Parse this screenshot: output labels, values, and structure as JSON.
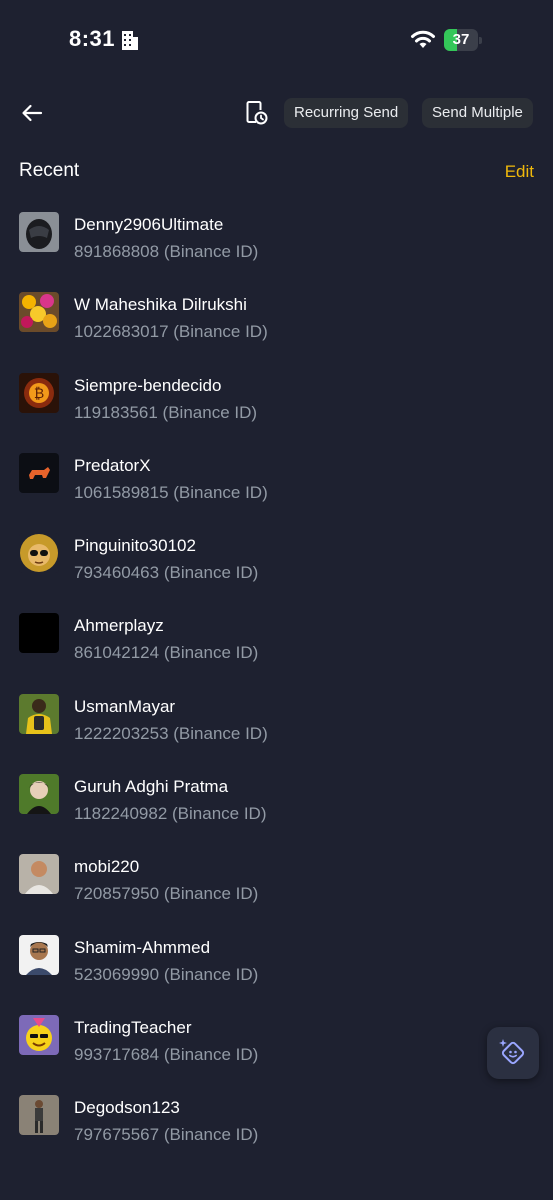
{
  "status_bar": {
    "time": "8:31",
    "battery": "37",
    "battery_level": 0.37,
    "battery_color": "#34c759"
  },
  "toolbar": {
    "back_icon": "arrow-left-icon",
    "history_icon": "clock-document-icon",
    "recurring_send_label": "Recurring Send",
    "send_multiple_label": "Send Multiple"
  },
  "recent": {
    "title": "Recent",
    "edit_label": "Edit",
    "contacts": [
      {
        "name": "Denny2906Ultimate",
        "id": "891868808 (Binance ID)",
        "avatar": "helmet"
      },
      {
        "name": "W Maheshika Dilrukshi",
        "id": "1022683017 (Binance ID)",
        "avatar": "flowers"
      },
      {
        "name": "Siempre-bendecido",
        "id": "119183561 (Binance ID)",
        "avatar": "bitcoin"
      },
      {
        "name": "PredatorX",
        "id": "1061589815 (Binance ID)",
        "avatar": "bull"
      },
      {
        "name": "Pinguinito30102",
        "id": "793460463 (Binance ID)",
        "avatar": "hooded"
      },
      {
        "name": "Ahmerplayz",
        "id": "861042124 (Binance ID)",
        "avatar": "black"
      },
      {
        "name": "UsmanMayar",
        "id": "1222203253 (Binance ID)",
        "avatar": "backpack"
      },
      {
        "name": "Guruh Adghi Pratma",
        "id": "1182240982 (Binance ID)",
        "avatar": "anime"
      },
      {
        "name": "mobi220",
        "id": "720857950 (Binance ID)",
        "avatar": "photo"
      },
      {
        "name": "Shamim-Ahmmed",
        "id": "523069990 (Binance ID)",
        "avatar": "portrait"
      },
      {
        "name": "TradingTeacher",
        "id": "993717684 (Binance ID)",
        "avatar": "emoji"
      },
      {
        "name": "Degodson123",
        "id": "797675567 (Binance ID)",
        "avatar": "standing"
      }
    ]
  },
  "assistant": {
    "icon": "sparkle-smile-icon"
  },
  "colors": {
    "background": "#1e2130",
    "accent": "#f0b90b",
    "muted_text": "#929aa5",
    "pill_bg": "#2b2f36"
  }
}
